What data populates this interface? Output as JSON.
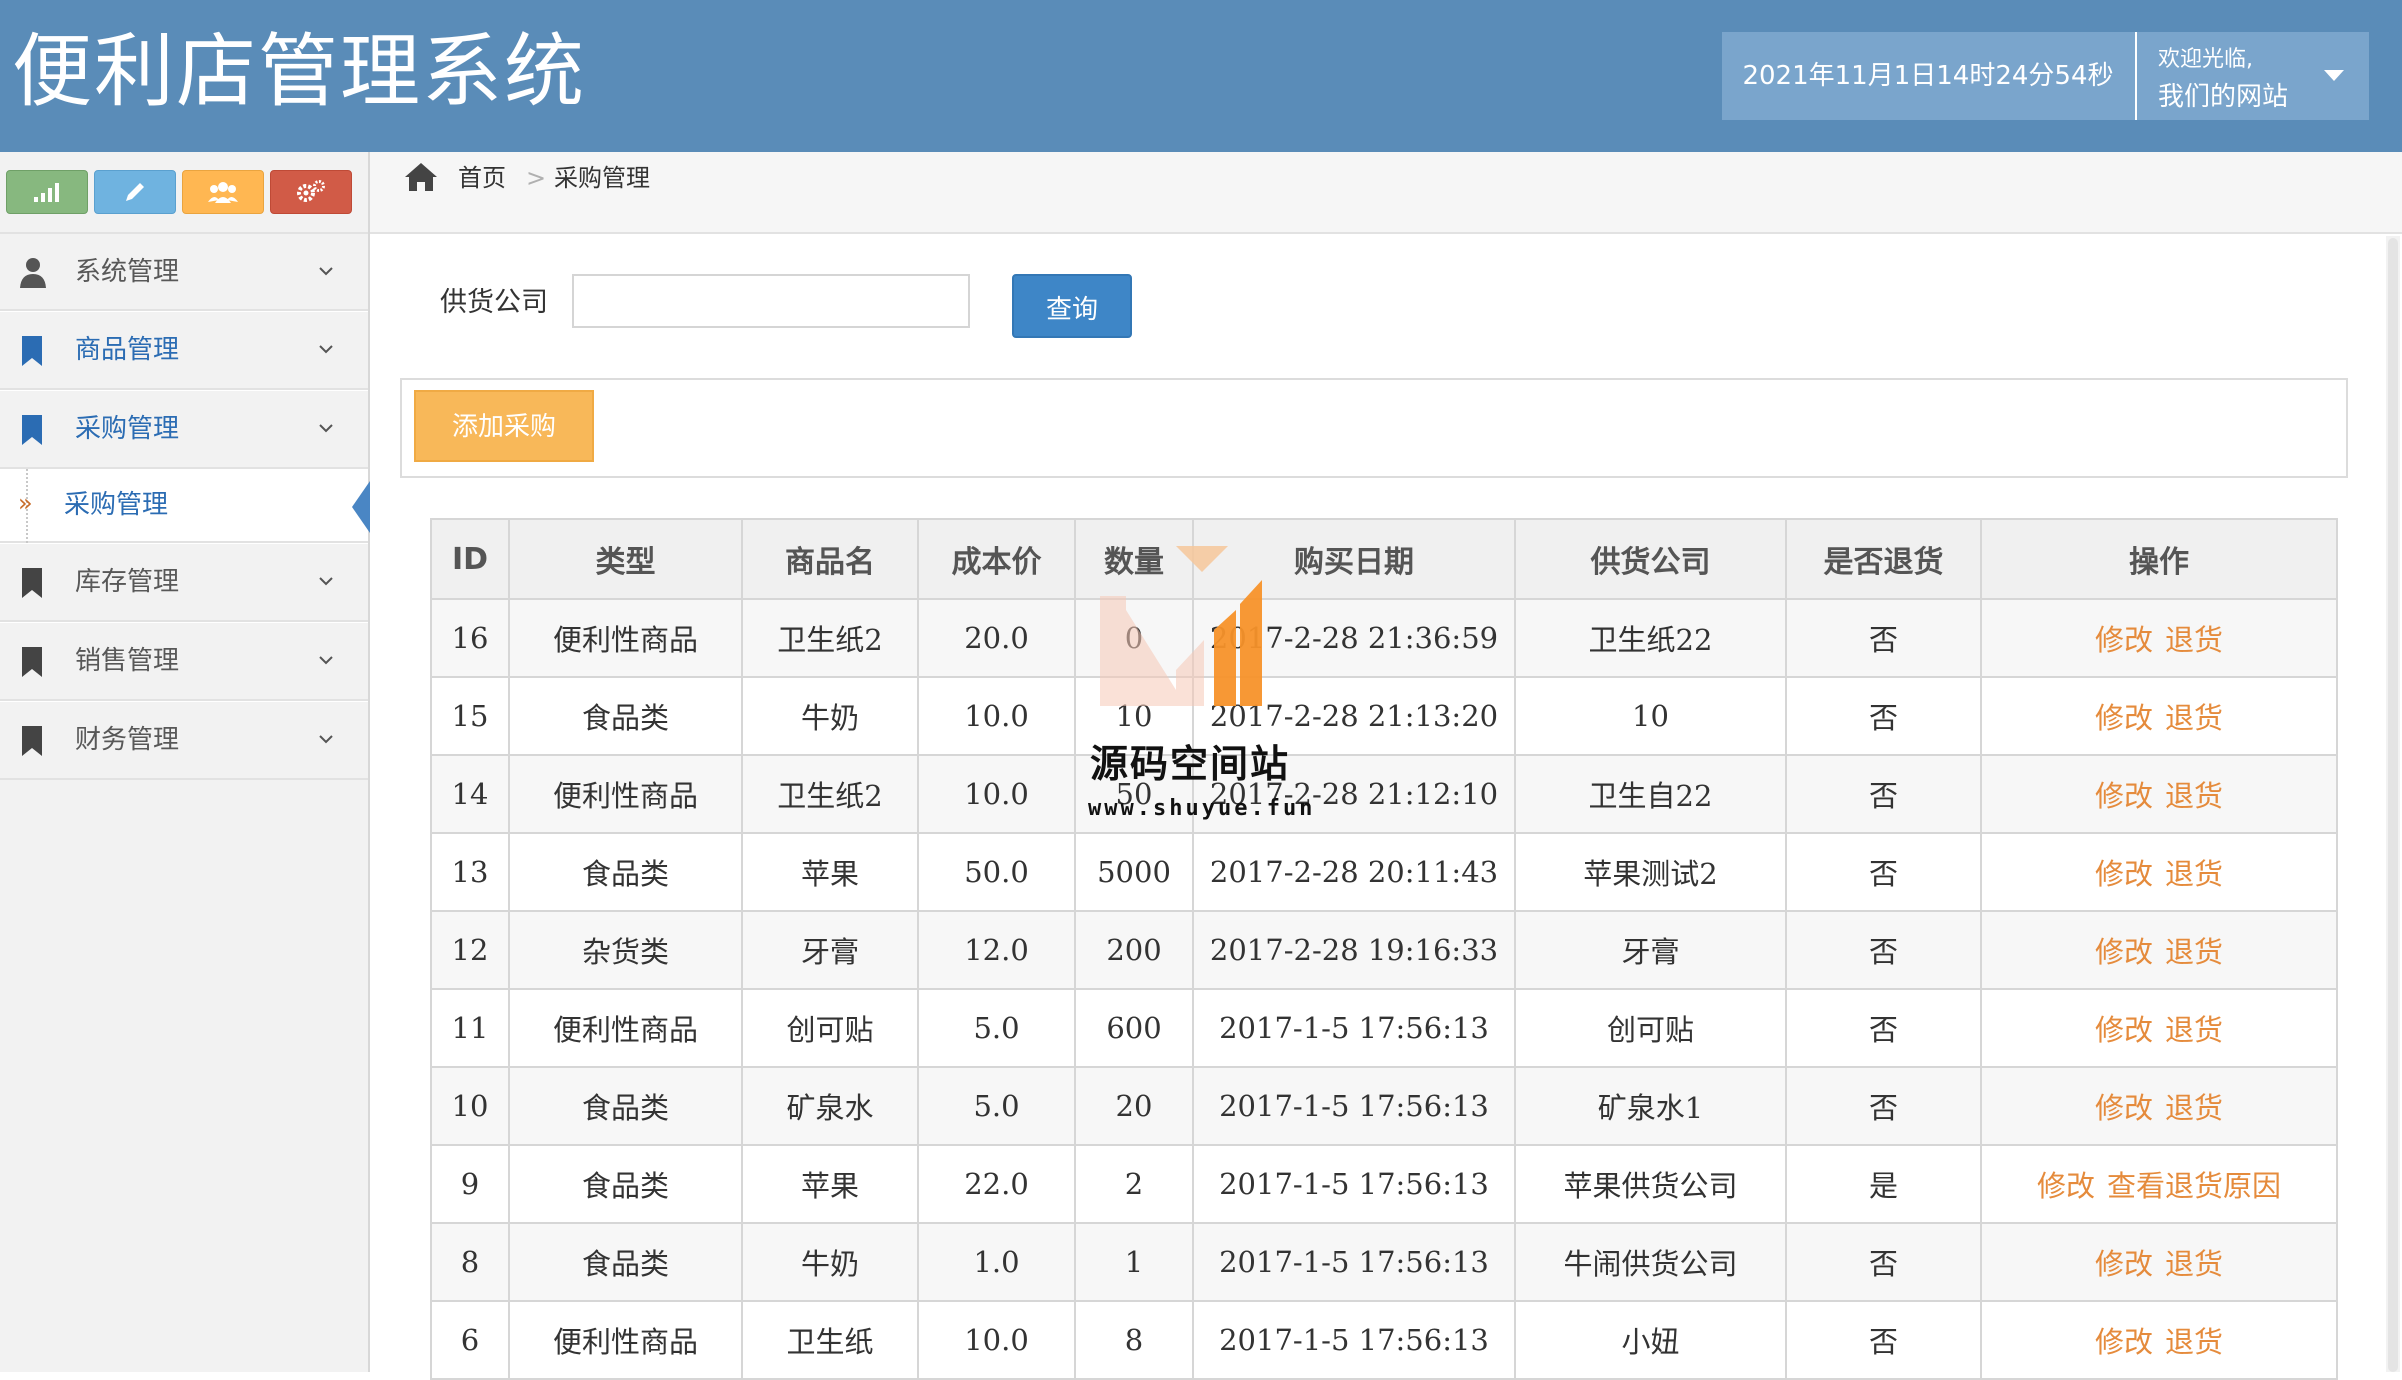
{
  "header": {
    "title": "便利店管理系统",
    "datetime": "2021年11月1日14时24分54秒",
    "welcome": "欢迎光临,",
    "user_name": "我们的网站"
  },
  "sidebar": {
    "shortcuts": [
      {
        "icon": "signal-bars-icon",
        "color": "#87b87f"
      },
      {
        "icon": "pencil-icon",
        "color": "#6fb3e0"
      },
      {
        "icon": "users-icon",
        "color": "#ffb752"
      },
      {
        "icon": "gears-icon",
        "color": "#d15b47"
      }
    ],
    "items": [
      {
        "label": "系统管理",
        "icon": "user-icon"
      },
      {
        "label": "商品管理",
        "icon": "bookmark-icon"
      },
      {
        "label": "采购管理",
        "icon": "bookmark-icon"
      },
      {
        "label": "库存管理",
        "icon": "bookmark-icon"
      },
      {
        "label": "销售管理",
        "icon": "bookmark-icon"
      },
      {
        "label": "财务管理",
        "icon": "bookmark-icon"
      }
    ],
    "sub_item": {
      "label": "采购管理",
      "arrow": "»"
    }
  },
  "breadcrumb": {
    "home": "首页",
    "separator": ">",
    "current": "采购管理"
  },
  "search": {
    "label": "供货公司",
    "value": "",
    "button": "查询"
  },
  "toolbar": {
    "add_label": "添加采购"
  },
  "table": {
    "headers": [
      "ID",
      "类型",
      "商品名",
      "成本价",
      "数量",
      "购买日期",
      "供货公司",
      "是否退货",
      "操作"
    ],
    "rows": [
      {
        "id": "16",
        "type": "便利性商品",
        "name": "卫生纸2",
        "cost": "20.0",
        "qty": "0",
        "date": "2017-2-28 21:36:59",
        "supplier": "卫生纸22",
        "returned": "否",
        "actions": [
          "修改",
          "退货"
        ]
      },
      {
        "id": "15",
        "type": "食品类",
        "name": "牛奶",
        "cost": "10.0",
        "qty": "10",
        "date": "2017-2-28 21:13:20",
        "supplier": "10",
        "returned": "否",
        "actions": [
          "修改",
          "退货"
        ]
      },
      {
        "id": "14",
        "type": "便利性商品",
        "name": "卫生纸2",
        "cost": "10.0",
        "qty": "50",
        "date": "2017-2-28 21:12:10",
        "supplier": "卫生自22",
        "returned": "否",
        "actions": [
          "修改",
          "退货"
        ]
      },
      {
        "id": "13",
        "type": "食品类",
        "name": "苹果",
        "cost": "50.0",
        "qty": "5000",
        "date": "2017-2-28 20:11:43",
        "supplier": "苹果测试2",
        "returned": "否",
        "actions": [
          "修改",
          "退货"
        ]
      },
      {
        "id": "12",
        "type": "杂货类",
        "name": "牙膏",
        "cost": "12.0",
        "qty": "200",
        "date": "2017-2-28 19:16:33",
        "supplier": "牙膏",
        "returned": "否",
        "actions": [
          "修改",
          "退货"
        ]
      },
      {
        "id": "11",
        "type": "便利性商品",
        "name": "创可贴",
        "cost": "5.0",
        "qty": "600",
        "date": "2017-1-5 17:56:13",
        "supplier": "创可贴",
        "returned": "否",
        "actions": [
          "修改",
          "退货"
        ]
      },
      {
        "id": "10",
        "type": "食品类",
        "name": "矿泉水",
        "cost": "5.0",
        "qty": "20",
        "date": "2017-1-5 17:56:13",
        "supplier": "矿泉水1",
        "returned": "否",
        "actions": [
          "修改",
          "退货"
        ]
      },
      {
        "id": "9",
        "type": "食品类",
        "name": "苹果",
        "cost": "22.0",
        "qty": "2",
        "date": "2017-1-5 17:56:13",
        "supplier": "苹果供货公司",
        "returned": "是",
        "actions": [
          "修改",
          "查看退货原因"
        ]
      },
      {
        "id": "8",
        "type": "食品类",
        "name": "牛奶",
        "cost": "1.0",
        "qty": "1",
        "date": "2017-1-5 17:56:13",
        "supplier": "牛闹供货公司",
        "returned": "否",
        "actions": [
          "修改",
          "退货"
        ]
      },
      {
        "id": "6",
        "type": "便利性商品",
        "name": "卫生纸",
        "cost": "10.0",
        "qty": "8",
        "date": "2017-1-5 17:56:13",
        "supplier": "小妞",
        "returned": "否",
        "actions": [
          "修改",
          "退货"
        ]
      }
    ]
  },
  "watermark": {
    "text": "源码空间站",
    "url": "www.shuyue.fun"
  },
  "colors": {
    "header_bg": "#5a8cb8",
    "user_box_bg": "#7aa5cc",
    "query_button": "#3e86c7",
    "add_button": "#f8b859",
    "action_link": "#e58b3c",
    "nav_active": "#2b6cb3"
  }
}
